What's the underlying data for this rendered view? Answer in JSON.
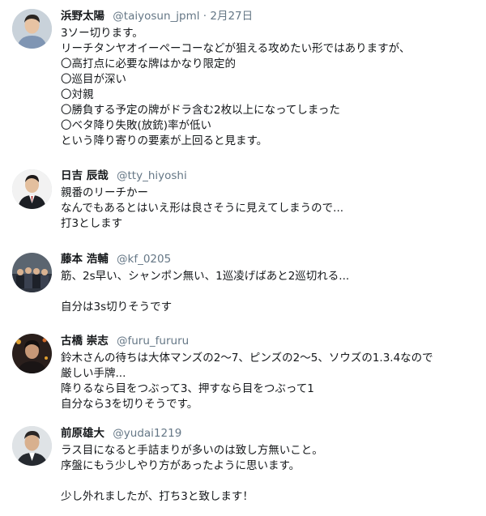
{
  "tweets": [
    {
      "name": "浜野太陽",
      "handle": "@taiyosun_jpml",
      "separator": " · ",
      "date": "2月27日",
      "lines": [
        "3ソー切ります。",
        "リーチタンヤオイーペーコーなどが狙える攻めたい形ではありますが、",
        "〇高打点に必要な牌はかなり限定的",
        "〇巡目が深い",
        "〇対親",
        "〇勝負する予定の牌がドラ含む2枚以上になってしまった",
        "〇ベタ降り失敗(放銃)率が低い",
        "という降り寄りの要素が上回ると見ます。"
      ]
    },
    {
      "name": "日吉 辰哉",
      "handle": "@tty_hiyoshi",
      "lines": [
        "親番のリーチかー",
        "なんでもあるとはいえ形は良さそうに見えてしまうので...",
        "打3とします"
      ]
    },
    {
      "name": "藤本 浩輔",
      "handle": "@kf_0205",
      "lines": [
        "筋、2s早い、シャンポン無い、1巡凌げばあと2巡切れる...",
        "",
        "自分は3s切りそうです"
      ]
    },
    {
      "name": "古橋 崇志",
      "handle": "@furu_fururu",
      "lines": [
        "鈴木さんの待ちは大体マンズの2～7、ピンズの2～5、ソウズの1.3.4なので",
        "厳しい手牌...",
        "降りるなら目をつぶって3、押すなら目をつぶって1",
        "自分なら3を切りそうです。"
      ]
    },
    {
      "name": "前原雄大",
      "handle": "@yudai1219",
      "lines": [
        "ラス目になると手詰まりが多いのは致し方無いこと。",
        "序盤にもう少しやり方があったように思います。",
        "",
        "少し外れましたが、打ち3と致します！"
      ]
    }
  ]
}
